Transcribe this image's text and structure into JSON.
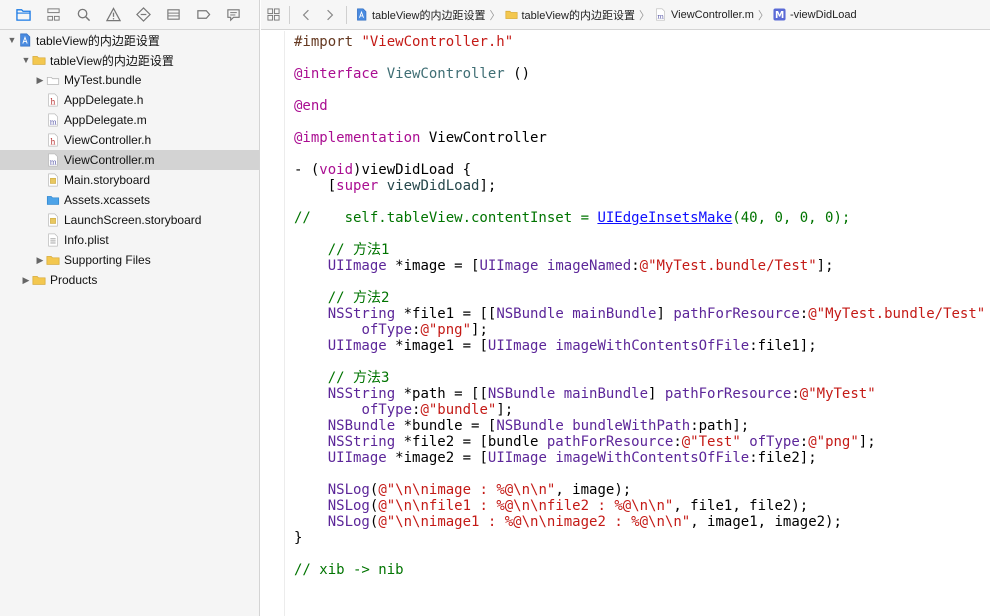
{
  "navigator": {
    "tabs": [
      "folder-icon",
      "hierarchy-icon",
      "search-icon",
      "warning-icon",
      "test-icon",
      "debug-icon",
      "breakpoint-icon",
      "report-icon"
    ],
    "tree": [
      {
        "label": "tableView的内边距设置",
        "indent": 0,
        "disclosure": "open",
        "icon": "project-icon"
      },
      {
        "label": "tableView的内边距设置",
        "indent": 1,
        "disclosure": "open",
        "icon": "folder-icon"
      },
      {
        "label": "MyTest.bundle",
        "indent": 2,
        "disclosure": "closed",
        "icon": "bundle-icon"
      },
      {
        "label": "AppDelegate.h",
        "indent": 2,
        "disclosure": "",
        "icon": "header-file-icon"
      },
      {
        "label": "AppDelegate.m",
        "indent": 2,
        "disclosure": "",
        "icon": "implementation-file-icon"
      },
      {
        "label": "ViewController.h",
        "indent": 2,
        "disclosure": "",
        "icon": "header-file-icon"
      },
      {
        "label": "ViewController.m",
        "indent": 2,
        "disclosure": "",
        "icon": "implementation-file-icon",
        "selected": true
      },
      {
        "label": "Main.storyboard",
        "indent": 2,
        "disclosure": "",
        "icon": "storyboard-icon"
      },
      {
        "label": "Assets.xcassets",
        "indent": 2,
        "disclosure": "",
        "icon": "assets-icon"
      },
      {
        "label": "LaunchScreen.storyboard",
        "indent": 2,
        "disclosure": "",
        "icon": "storyboard-icon"
      },
      {
        "label": "Info.plist",
        "indent": 2,
        "disclosure": "",
        "icon": "plist-icon"
      },
      {
        "label": "Supporting Files",
        "indent": 2,
        "disclosure": "closed",
        "icon": "folder-icon"
      },
      {
        "label": "Products",
        "indent": 1,
        "disclosure": "closed",
        "icon": "folder-icon"
      }
    ]
  },
  "jumpbar": {
    "crumbs": [
      {
        "label": "tableView的内边距设置",
        "icon": "project-icon"
      },
      {
        "label": "tableView的内边距设置",
        "icon": "folder-icon"
      },
      {
        "label": "ViewController.m",
        "icon": "implementation-file-icon"
      },
      {
        "label": "-viewDidLoad",
        "icon": "method-icon"
      }
    ]
  },
  "code": {
    "lines": [
      [
        [
          "dir",
          "#import "
        ],
        [
          "str",
          "\"ViewController.h\""
        ]
      ],
      [],
      [
        [
          "kw",
          "@interface "
        ],
        [
          "cls",
          "ViewController"
        ],
        [
          "pln",
          " ()"
        ]
      ],
      [],
      [
        [
          "kw",
          "@end"
        ]
      ],
      [],
      [
        [
          "kw",
          "@implementation "
        ],
        [
          "pln",
          "ViewController"
        ]
      ],
      [],
      [
        [
          "pln",
          "- ("
        ],
        [
          "kw",
          "void"
        ],
        [
          "pln",
          ")viewDidLoad {"
        ]
      ],
      [
        [
          "pln",
          "    ["
        ],
        [
          "kw",
          "super"
        ],
        [
          "pln",
          " "
        ],
        [
          "mth",
          "viewDidLoad"
        ],
        [
          "pln",
          "];"
        ]
      ],
      [],
      [
        [
          "com",
          "//    self.tableView.contentInset = "
        ],
        [
          "lnk",
          "UIEdgeInsetsMake"
        ],
        [
          "com",
          "(40, 0, 0, 0);"
        ]
      ],
      [],
      [
        [
          "com",
          "    // 方法1"
        ]
      ],
      [
        [
          "pln",
          "    "
        ],
        [
          "sys",
          "UIImage"
        ],
        [
          "pln",
          " *image = ["
        ],
        [
          "sys",
          "UIImage"
        ],
        [
          "pln",
          " "
        ],
        [
          "sys",
          "imageNamed"
        ],
        [
          "pln",
          ":"
        ],
        [
          "str",
          "@\"MyTest.bundle/Test\""
        ],
        [
          "pln",
          "];"
        ]
      ],
      [],
      [
        [
          "com",
          "    // 方法2"
        ]
      ],
      [
        [
          "pln",
          "    "
        ],
        [
          "sys",
          "NSString"
        ],
        [
          "pln",
          " *file1 = [["
        ],
        [
          "sys",
          "NSBundle"
        ],
        [
          "pln",
          " "
        ],
        [
          "sys",
          "mainBundle"
        ],
        [
          "pln",
          "] "
        ],
        [
          "sys",
          "pathForResource"
        ],
        [
          "pln",
          ":"
        ],
        [
          "str",
          "@\"MyTest.bundle/Test\""
        ]
      ],
      [
        [
          "pln",
          "        "
        ],
        [
          "sys",
          "ofType"
        ],
        [
          "pln",
          ":"
        ],
        [
          "str",
          "@\"png\""
        ],
        [
          "pln",
          "];"
        ]
      ],
      [
        [
          "pln",
          "    "
        ],
        [
          "sys",
          "UIImage"
        ],
        [
          "pln",
          " *image1 = ["
        ],
        [
          "sys",
          "UIImage"
        ],
        [
          "pln",
          " "
        ],
        [
          "sys",
          "imageWithContentsOfFile"
        ],
        [
          "pln",
          ":file1];"
        ]
      ],
      [],
      [
        [
          "com",
          "    // 方法3"
        ]
      ],
      [
        [
          "pln",
          "    "
        ],
        [
          "sys",
          "NSString"
        ],
        [
          "pln",
          " *path = [["
        ],
        [
          "sys",
          "NSBundle"
        ],
        [
          "pln",
          " "
        ],
        [
          "sys",
          "mainBundle"
        ],
        [
          "pln",
          "] "
        ],
        [
          "sys",
          "pathForResource"
        ],
        [
          "pln",
          ":"
        ],
        [
          "str",
          "@\"MyTest\""
        ]
      ],
      [
        [
          "pln",
          "        "
        ],
        [
          "sys",
          "ofType"
        ],
        [
          "pln",
          ":"
        ],
        [
          "str",
          "@\"bundle\""
        ],
        [
          "pln",
          "];"
        ]
      ],
      [
        [
          "pln",
          "    "
        ],
        [
          "sys",
          "NSBundle"
        ],
        [
          "pln",
          " *bundle = ["
        ],
        [
          "sys",
          "NSBundle"
        ],
        [
          "pln",
          " "
        ],
        [
          "sys",
          "bundleWithPath"
        ],
        [
          "pln",
          ":path];"
        ]
      ],
      [
        [
          "pln",
          "    "
        ],
        [
          "sys",
          "NSString"
        ],
        [
          "pln",
          " *file2 = [bundle "
        ],
        [
          "sys",
          "pathForResource"
        ],
        [
          "pln",
          ":"
        ],
        [
          "str",
          "@\"Test\""
        ],
        [
          "pln",
          " "
        ],
        [
          "sys",
          "ofType"
        ],
        [
          "pln",
          ":"
        ],
        [
          "str",
          "@\"png\""
        ],
        [
          "pln",
          "];"
        ]
      ],
      [
        [
          "pln",
          "    "
        ],
        [
          "sys",
          "UIImage"
        ],
        [
          "pln",
          " *image2 = ["
        ],
        [
          "sys",
          "UIImage"
        ],
        [
          "pln",
          " "
        ],
        [
          "sys",
          "imageWithContentsOfFile"
        ],
        [
          "pln",
          ":file2];"
        ]
      ],
      [],
      [
        [
          "pln",
          "    "
        ],
        [
          "sys",
          "NSLog"
        ],
        [
          "pln",
          "("
        ],
        [
          "str",
          "@\"\\n\\nimage : %@\\n\\n\""
        ],
        [
          "pln",
          ", image);"
        ]
      ],
      [
        [
          "pln",
          "    "
        ],
        [
          "sys",
          "NSLog"
        ],
        [
          "pln",
          "("
        ],
        [
          "str",
          "@\"\\n\\nfile1 : %@\\n\\nfile2 : %@\\n\\n\""
        ],
        [
          "pln",
          ", file1, file2);"
        ]
      ],
      [
        [
          "pln",
          "    "
        ],
        [
          "sys",
          "NSLog"
        ],
        [
          "pln",
          "("
        ],
        [
          "str",
          "@\"\\n\\nimage1 : %@\\n\\nimage2 : %@\\n\\n\""
        ],
        [
          "pln",
          ", image1, image2);"
        ]
      ],
      [
        [
          "pln",
          "}"
        ]
      ],
      [],
      [
        [
          "com",
          "// xib -> nib"
        ]
      ]
    ]
  },
  "colors": {
    "selection": "#d3d3d3",
    "comment": "#007400",
    "string": "#c41a16",
    "keyword": "#aa0d91",
    "system": "#5c2699",
    "directive": "#643820",
    "link": "#0e0eff"
  }
}
